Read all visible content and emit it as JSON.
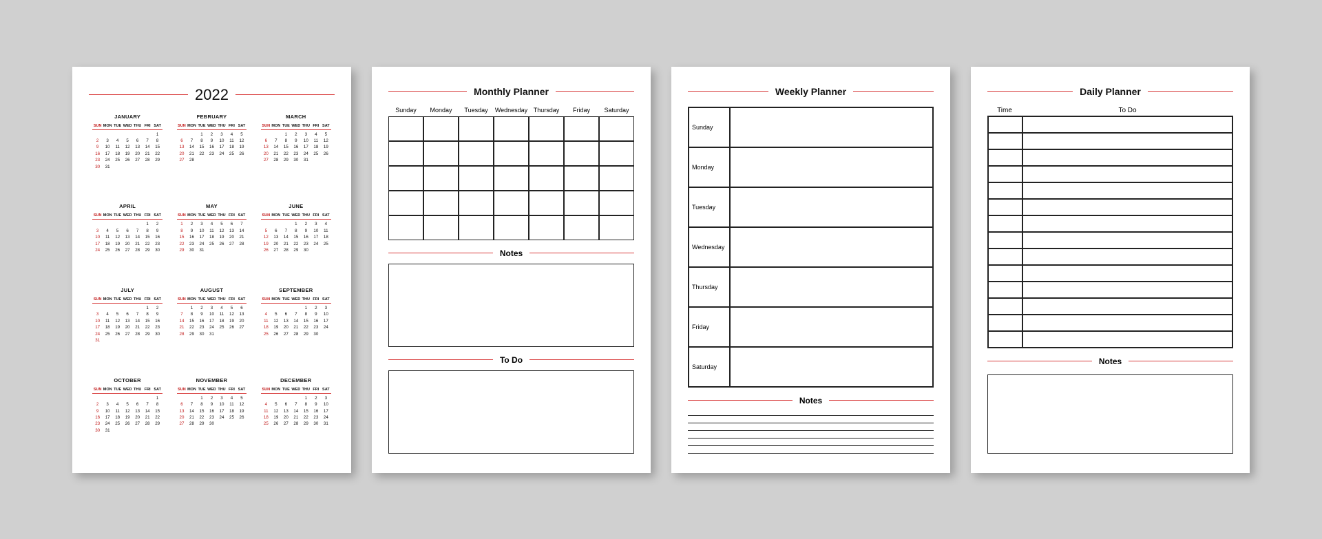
{
  "year": "2022",
  "dow_short": [
    "SUN",
    "MON",
    "TUE",
    "WED",
    "THU",
    "FRI",
    "SAT"
  ],
  "dow_long": [
    "Sunday",
    "Monday",
    "Tuesday",
    "Wednesday",
    "Thursday",
    "Friday",
    "Saturday"
  ],
  "months": [
    {
      "name": "JANUARY",
      "start": 6,
      "days": 31
    },
    {
      "name": "FEBRUARY",
      "start": 2,
      "days": 28
    },
    {
      "name": "MARCH",
      "start": 2,
      "days": 31
    },
    {
      "name": "APRIL",
      "start": 5,
      "days": 30
    },
    {
      "name": "MAY",
      "start": 0,
      "days": 31
    },
    {
      "name": "JUNE",
      "start": 3,
      "days": 30
    },
    {
      "name": "JULY",
      "start": 5,
      "days": 31
    },
    {
      "name": "AUGUST",
      "start": 1,
      "days": 31
    },
    {
      "name": "SEPTEMBER",
      "start": 4,
      "days": 30
    },
    {
      "name": "OCTOBER",
      "start": 6,
      "days": 31
    },
    {
      "name": "NOVEMBER",
      "start": 2,
      "days": 30
    },
    {
      "name": "DECEMBER",
      "start": 4,
      "days": 31
    }
  ],
  "monthly": {
    "title": "Monthly Planner",
    "notes": "Notes",
    "todo": "To Do",
    "rows": 5,
    "cols": 7
  },
  "weekly": {
    "title": "Weekly Planner",
    "notes": "Notes",
    "lines": 6
  },
  "daily": {
    "title": "Daily Planner",
    "time": "Time",
    "todo": "To Do",
    "notes": "Notes",
    "rows": 14
  }
}
